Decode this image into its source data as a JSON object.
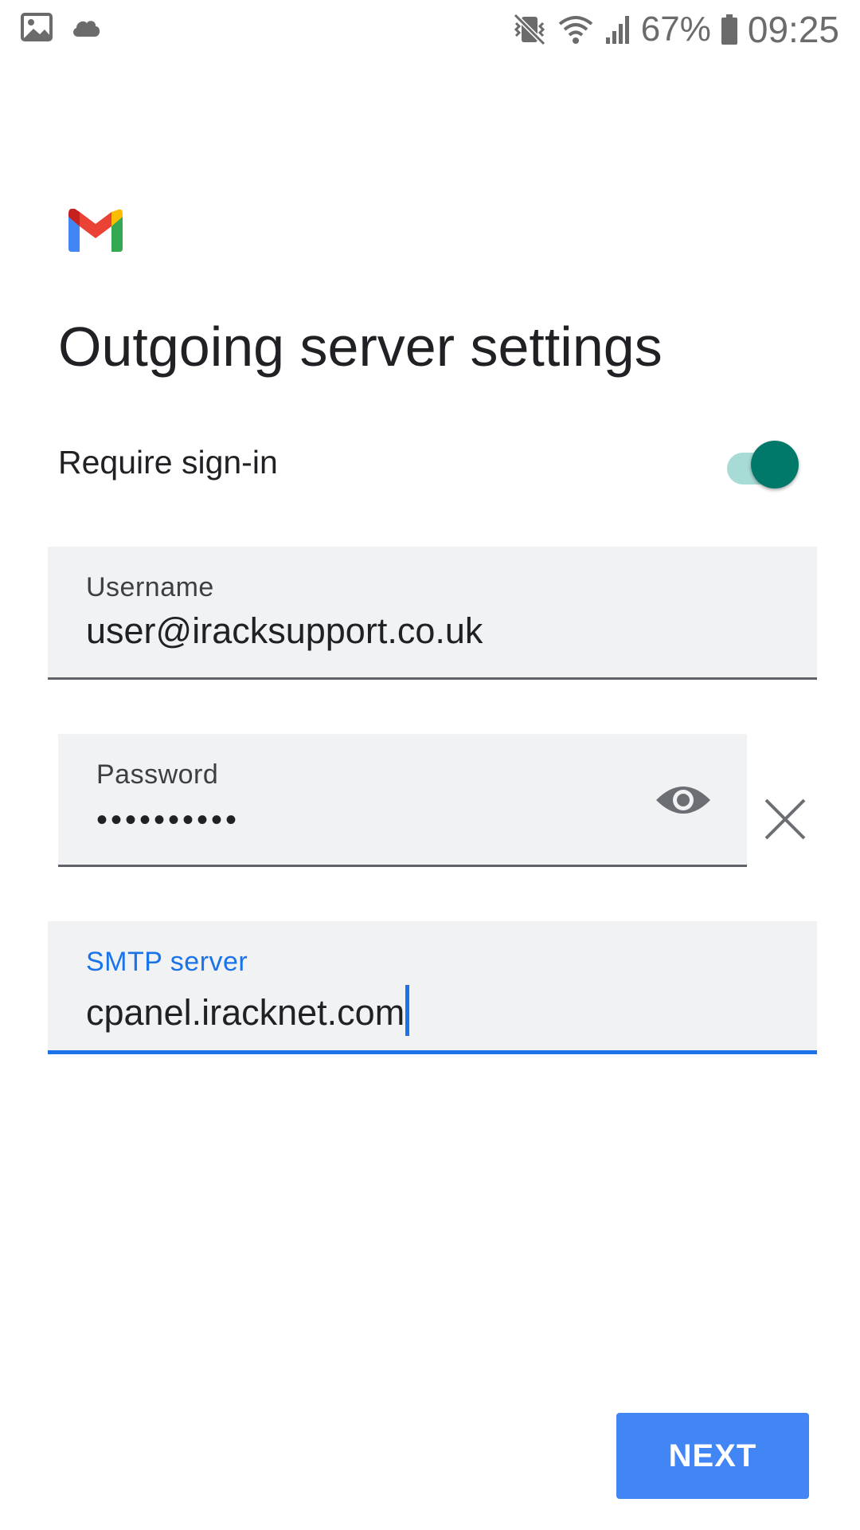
{
  "status_bar": {
    "left_icons": [
      "gallery-icon",
      "cloud-icon"
    ],
    "right_icons": [
      "vibrate-mute-icon",
      "wifi-icon",
      "signal-icon",
      "battery-icon"
    ],
    "battery_percent": "67%",
    "time": "09:25"
  },
  "app": {
    "logo": "gmail-logo"
  },
  "page": {
    "title": "Outgoing server settings"
  },
  "require_signin": {
    "label": "Require sign-in",
    "enabled": true
  },
  "username": {
    "label": "Username",
    "value": "user@iracksupport.co.uk"
  },
  "password": {
    "label": "Password",
    "value": "••••••••••",
    "icons": [
      "eye-icon",
      "close-icon"
    ]
  },
  "smtp": {
    "label": "SMTP server",
    "value": "cpanel.iracknet.com"
  },
  "actions": {
    "next_label": "NEXT"
  },
  "colors": {
    "accent": "#1a73e8",
    "toggle_on": "#00796b",
    "toggle_track": "#a7dbd5",
    "button": "#4285f4",
    "field_bg": "#f1f2f4"
  }
}
